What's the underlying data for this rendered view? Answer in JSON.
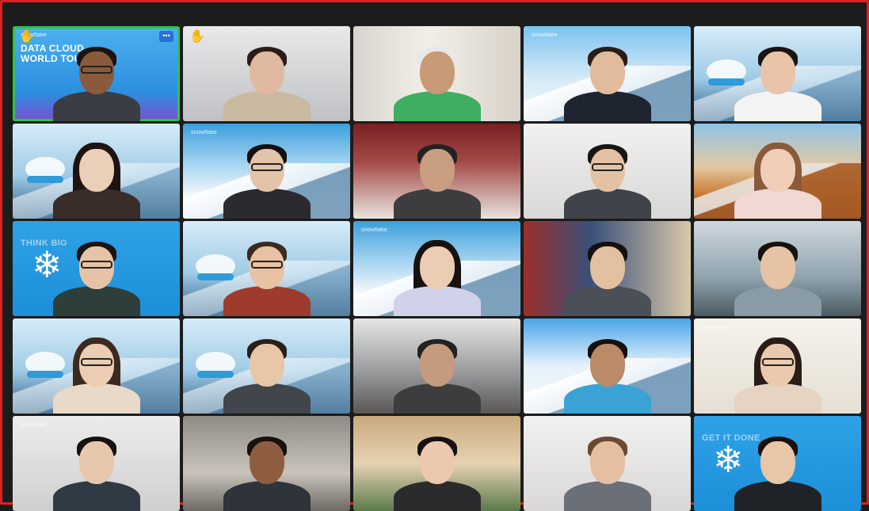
{
  "meeting": {
    "tiles": [
      {
        "row": 1,
        "col": 1,
        "bg": "blue-city",
        "bg_text_small": "snowflake",
        "bg_text": "DATA CLOUD WORLD TOUR",
        "hand": true,
        "menu": "•••",
        "speaking": true,
        "skin": "#8a5a3c",
        "hair": "#1b1410",
        "shirt": "#3a3d44",
        "glasses": true
      },
      {
        "row": 1,
        "col": 2,
        "bg": "office-grey",
        "hand": true,
        "skin": "#e0b9a0",
        "hair": "#2a1d18",
        "shirt": "#c9b9a0"
      },
      {
        "row": 1,
        "col": 3,
        "bg": "home",
        "skin": "#c99a76",
        "hair": "#e8e8e8",
        "shirt": "#3fae61"
      },
      {
        "row": 1,
        "col": 4,
        "bg": "snow-mountain",
        "bg_text_small": "snowflake",
        "skin": "#e2bb9c",
        "hair": "#2a1d18",
        "shirt": "#1f2530"
      },
      {
        "row": 1,
        "col": 5,
        "bg": "yeti",
        "skin": "#e9c4a8",
        "hair": "#1a1413",
        "shirt": "#f4f4f4"
      },
      {
        "row": 2,
        "col": 1,
        "bg": "yeti",
        "long_hair": true,
        "skin": "#ead0b8",
        "hair": "#1d1412",
        "shirt": "#3a2c28"
      },
      {
        "row": 2,
        "col": 2,
        "bg": "snow-forest",
        "bg_text_small": "snowflake",
        "skin": "#e4c4a8",
        "hair": "#141010",
        "shirt": "#2a2a2e",
        "glasses": true
      },
      {
        "row": 2,
        "col": 3,
        "bg": "conference-room",
        "skin": "#c89d80",
        "hair": "#222",
        "shirt": "#3d3d40"
      },
      {
        "row": 2,
        "col": 4,
        "bg": "white-room",
        "skin": "#e3c2a4",
        "hair": "#1a1412",
        "shirt": "#40434a",
        "glasses": true
      },
      {
        "row": 2,
        "col": 5,
        "bg": "autumn-mountain",
        "long_hair": true,
        "skin": "#f0cdb6",
        "hair": "#8a5a3a",
        "shirt": "#f1d8d2"
      },
      {
        "row": 3,
        "col": 1,
        "bg": "blue-snowflake",
        "bg_text": "THINK BIG",
        "skin": "#e6c3a6",
        "hair": "#1a1412",
        "shirt": "#2e3e3b",
        "glasses": true
      },
      {
        "row": 3,
        "col": 2,
        "bg": "yeti",
        "skin": "#e8c2a2",
        "hair": "#3b2a1f",
        "shirt": "#9e3b2d",
        "glasses": true
      },
      {
        "row": 3,
        "col": 3,
        "bg": "snow-forest",
        "bg_text_small": "snowflake",
        "long_hair": true,
        "skin": "#ecccb2",
        "hair": "#17110f",
        "shirt": "#cfd2e8"
      },
      {
        "row": 3,
        "col": 4,
        "bg": "posters",
        "skin": "#e3c0a0",
        "hair": "#15110f",
        "shirt": "#4b4f57"
      },
      {
        "row": 3,
        "col": 5,
        "bg": "office-window",
        "skin": "#e7c3a5",
        "hair": "#17110f",
        "shirt": "#8a9ba8"
      },
      {
        "row": 4,
        "col": 1,
        "bg": "yeti",
        "long_hair": true,
        "skin": "#ecccb2",
        "hair": "#3c2a20",
        "shirt": "#e8d9c8",
        "glasses": true
      },
      {
        "row": 4,
        "col": 2,
        "bg": "yeti",
        "skin": "#e8c6a8",
        "hair": "#2a1f1a",
        "shirt": "#41464c"
      },
      {
        "row": 4,
        "col": 3,
        "bg": "meeting-room",
        "skin": "#c59a7e",
        "hair": "#222",
        "shirt": "#3d3d40"
      },
      {
        "row": 4,
        "col": 4,
        "bg": "sky-mountain",
        "skin": "#bb8a66",
        "hair": "#141010",
        "shirt": "#3ba3d4"
      },
      {
        "row": 4,
        "col": 5,
        "bg": "bright-room",
        "bg_text_small": "snowflake",
        "long_hair": true,
        "skin": "#ecc9ae",
        "hair": "#2a1d18",
        "shirt": "#e6d3c2",
        "glasses": true
      },
      {
        "row": 5,
        "col": 1,
        "bg": "living-room",
        "bg_text_small": "snowflake",
        "skin": "#e8c8ac",
        "hair": "#17110f",
        "shirt": "#2f3a45"
      },
      {
        "row": 5,
        "col": 2,
        "bg": "dim-room",
        "skin": "#8e5d40",
        "hair": "#17110f",
        "shirt": "#2f333a"
      },
      {
        "row": 5,
        "col": 3,
        "bg": "wood-office",
        "skin": "#ecc9ae",
        "hair": "#17110f",
        "shirt": "#2b2b2e"
      },
      {
        "row": 5,
        "col": 4,
        "bg": "white-room",
        "skin": "#e6bfa2",
        "hair": "#6b4a32",
        "shirt": "#6a6f78"
      },
      {
        "row": 5,
        "col": 5,
        "bg": "blue-snowflake",
        "bg_text": "GET IT DONE",
        "skin": "#e8c6a8",
        "hair": "#17110f",
        "shirt": "#1f2328"
      }
    ]
  }
}
